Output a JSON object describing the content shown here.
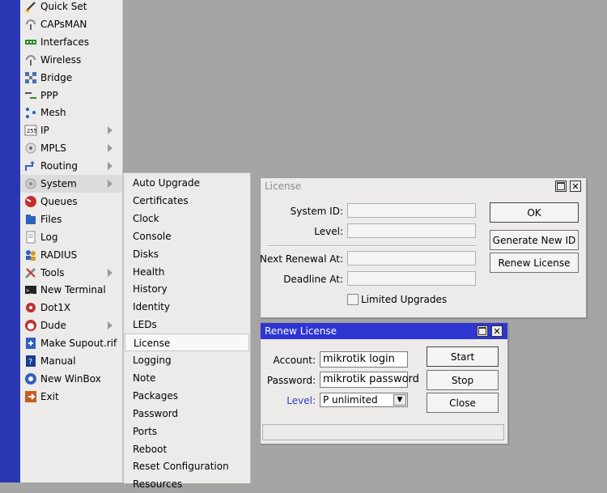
{
  "sidebar": {
    "items": [
      {
        "label": "Quick Set",
        "icon": "quick-set-icon",
        "arrow": false
      },
      {
        "label": "CAPsMAN",
        "icon": "capsman-icon",
        "arrow": false
      },
      {
        "label": "Interfaces",
        "icon": "interfaces-icon",
        "arrow": false
      },
      {
        "label": "Wireless",
        "icon": "wireless-icon",
        "arrow": false
      },
      {
        "label": "Bridge",
        "icon": "bridge-icon",
        "arrow": false
      },
      {
        "label": "PPP",
        "icon": "ppp-icon",
        "arrow": false
      },
      {
        "label": "Mesh",
        "icon": "mesh-icon",
        "arrow": false
      },
      {
        "label": "IP",
        "icon": "ip-icon",
        "arrow": true
      },
      {
        "label": "MPLS",
        "icon": "mpls-icon",
        "arrow": true
      },
      {
        "label": "Routing",
        "icon": "routing-icon",
        "arrow": true
      },
      {
        "label": "System",
        "icon": "system-icon",
        "arrow": true
      },
      {
        "label": "Queues",
        "icon": "queues-icon",
        "arrow": false
      },
      {
        "label": "Files",
        "icon": "files-icon",
        "arrow": false
      },
      {
        "label": "Log",
        "icon": "log-icon",
        "arrow": false
      },
      {
        "label": "RADIUS",
        "icon": "radius-icon",
        "arrow": false
      },
      {
        "label": "Tools",
        "icon": "tools-icon",
        "arrow": true
      },
      {
        "label": "New Terminal",
        "icon": "terminal-icon",
        "arrow": false
      },
      {
        "label": "Dot1X",
        "icon": "dot1x-icon",
        "arrow": false
      },
      {
        "label": "Dude",
        "icon": "dude-icon",
        "arrow": true
      },
      {
        "label": "Make Supout.rif",
        "icon": "supout-icon",
        "arrow": false
      },
      {
        "label": "Manual",
        "icon": "manual-icon",
        "arrow": false
      },
      {
        "label": "New WinBox",
        "icon": "winbox-icon",
        "arrow": false
      },
      {
        "label": "Exit",
        "icon": "exit-icon",
        "arrow": false
      }
    ]
  },
  "system_submenu": {
    "items": [
      "Auto Upgrade",
      "Certificates",
      "Clock",
      "Console",
      "Disks",
      "Health",
      "History",
      "Identity",
      "LEDs",
      "License",
      "Logging",
      "Note",
      "Packages",
      "Password",
      "Ports",
      "Reboot",
      "Reset Configuration",
      "Resources"
    ],
    "selected": "License"
  },
  "license_window": {
    "title": "License",
    "system_id_label": "System ID:",
    "system_id_value": "",
    "level_label": "Level:",
    "level_value": "",
    "next_renewal_label": "Next Renewal At:",
    "next_renewal_value": "",
    "deadline_label": "Deadline At:",
    "deadline_value": "",
    "limited_upgrades_label": "Limited Upgrades",
    "limited_upgrades_checked": false,
    "ok_label": "OK",
    "generate_label": "Generate New ID",
    "renew_label": "Renew License"
  },
  "renew_window": {
    "title": "Renew License",
    "account_label": "Account:",
    "account_value": "mikrotik login",
    "password_label": "Password:",
    "password_value": "mikrotik password",
    "level_label": "Level:",
    "level_value": "P unlimited",
    "start_label": "Start",
    "stop_label": "Stop",
    "close_label": "Close",
    "status": ""
  },
  "colors": {
    "desktop": "#a5a5a5",
    "side_strip": "#2a37b2",
    "panel": "#ecebe9",
    "active_titlebar": "#2e35d3",
    "level_label": "#3040c8"
  }
}
